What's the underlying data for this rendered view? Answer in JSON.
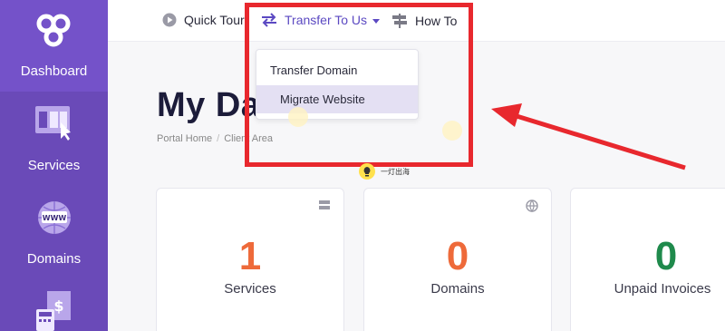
{
  "sidebar": {
    "items": [
      {
        "label": "Dashboard",
        "icon": "logo-icon"
      },
      {
        "label": "Services",
        "icon": "services-icon"
      },
      {
        "label": "Domains",
        "icon": "www-globe-icon"
      },
      {
        "label": "",
        "icon": "billing-calculator-icon"
      }
    ]
  },
  "topbar": {
    "quick_tour": "Quick Tour",
    "transfer": "Transfer To Us",
    "howto": "How To"
  },
  "dropdown": {
    "items": [
      "Transfer Domain",
      "Migrate Website"
    ],
    "selected": "Migrate Website"
  },
  "page": {
    "title": "My Da",
    "breadcrumb": [
      "Portal Home",
      "Client Area"
    ]
  },
  "tip": {
    "text": "一灯出海"
  },
  "cards": [
    {
      "value": "1",
      "label": "Services",
      "color": "#ee6a3a",
      "icon": "server-icon"
    },
    {
      "value": "0",
      "label": "Domains",
      "color": "#ee6a3a",
      "icon": "globe-icon"
    },
    {
      "value": "0",
      "label": "Unpaid Invoices",
      "color": "#1f8a4c",
      "icon": ""
    }
  ],
  "colors": {
    "sidebar": "#6a4ab8",
    "accent": "#5b49c2",
    "highlight": "#e8282e"
  }
}
